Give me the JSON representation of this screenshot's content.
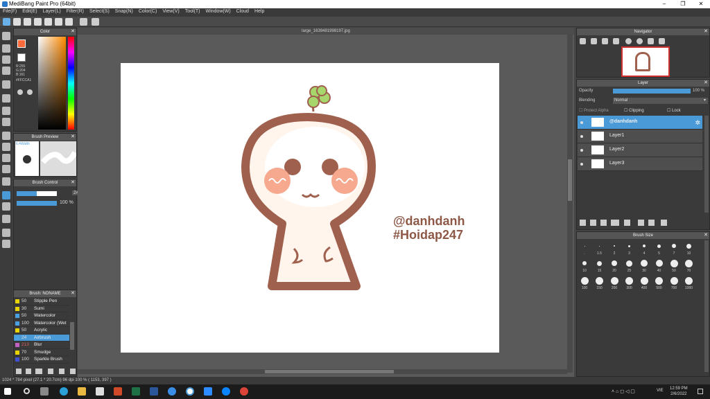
{
  "title": "MediBang Paint Pro (64bit)",
  "menu": [
    "File(F)",
    "Edit(E)",
    "Layer(L)",
    "Filter(R)",
    "Select(S)",
    "Snap(N)",
    "Color(C)",
    "View(V)",
    "Tool(T)",
    "Window(W)",
    "Cloud",
    "Help"
  ],
  "document_tab": "large_1639481998197.jpg",
  "color_panel": {
    "title": "Color",
    "r": "R:255",
    "g": "G:204",
    "b": "B:161",
    "hex": "#FFCCA1"
  },
  "brush_preview": {
    "title": "Brush Preview",
    "width_label": "6.4Width"
  },
  "brush_control": {
    "title": "Brush Control",
    "size": "24",
    "opacity": "100 %",
    "size_fill": 0.5,
    "opacity_fill": 1.0
  },
  "brush_list": {
    "title": "Brush: NONAME",
    "items": [
      {
        "size": "50",
        "name": "Stipple Pen",
        "color": "#e8d400"
      },
      {
        "size": "30",
        "name": "Sumi",
        "color": "#e8d400"
      },
      {
        "size": "50",
        "name": "Watercolor",
        "color": "#4aa0e0"
      },
      {
        "size": "100",
        "name": "Watercolor (Wet",
        "color": "#4aa0e0"
      },
      {
        "size": "50",
        "name": "Acrylic",
        "color": "#e8d400"
      },
      {
        "size": "24",
        "name": "Airbrush",
        "color": "#4aa0e0",
        "selected": true
      },
      {
        "size": "213",
        "name": "Blur",
        "color": "#c060c0"
      },
      {
        "size": "70",
        "name": "Smudge",
        "color": "#e8d400"
      },
      {
        "size": "100",
        "name": "Sparkle Brush",
        "color": "#4050d0"
      }
    ]
  },
  "navigator": {
    "title": "Navigator"
  },
  "layer_panel": {
    "title": "Layer",
    "opacity_label": "Opacity",
    "opacity_value": "100 %",
    "blending_label": "Blending",
    "blending_value": "Normal",
    "protect_alpha": "Protect Alpha",
    "clipping": "Clipping",
    "lock": "Lock",
    "layers": [
      {
        "name": "@danhdanh",
        "selected": true
      },
      {
        "name": "Layer1",
        "selected": false
      },
      {
        "name": "Layer2",
        "selected": false
      },
      {
        "name": "Layer3",
        "selected": false
      }
    ]
  },
  "brush_size": {
    "title": "Brush Size",
    "row1": [
      ".",
      "1.5",
      "2",
      "3",
      "4",
      "5",
      "7",
      "10"
    ],
    "row2": [
      "10",
      "15",
      "20",
      "25",
      "30",
      "40",
      "50",
      "70"
    ],
    "row3": [
      "100",
      "150",
      "200",
      "300",
      "400",
      "500",
      "700",
      "1000"
    ]
  },
  "canvas_text": {
    "line1": "@danhdanh",
    "line2": "#Hoidap247"
  },
  "status": "1024 * 784 pixel   (27.1 * 20.7cm)   96 dpi   100 %   ( 1153, 397 )",
  "taskbar": {
    "lang": "VIE",
    "time": "12:59 PM",
    "date": "2/6/2022"
  },
  "colors": {
    "brown": "#a0604e",
    "accent": "#4a9ad8",
    "blush": "#f6a98e"
  }
}
